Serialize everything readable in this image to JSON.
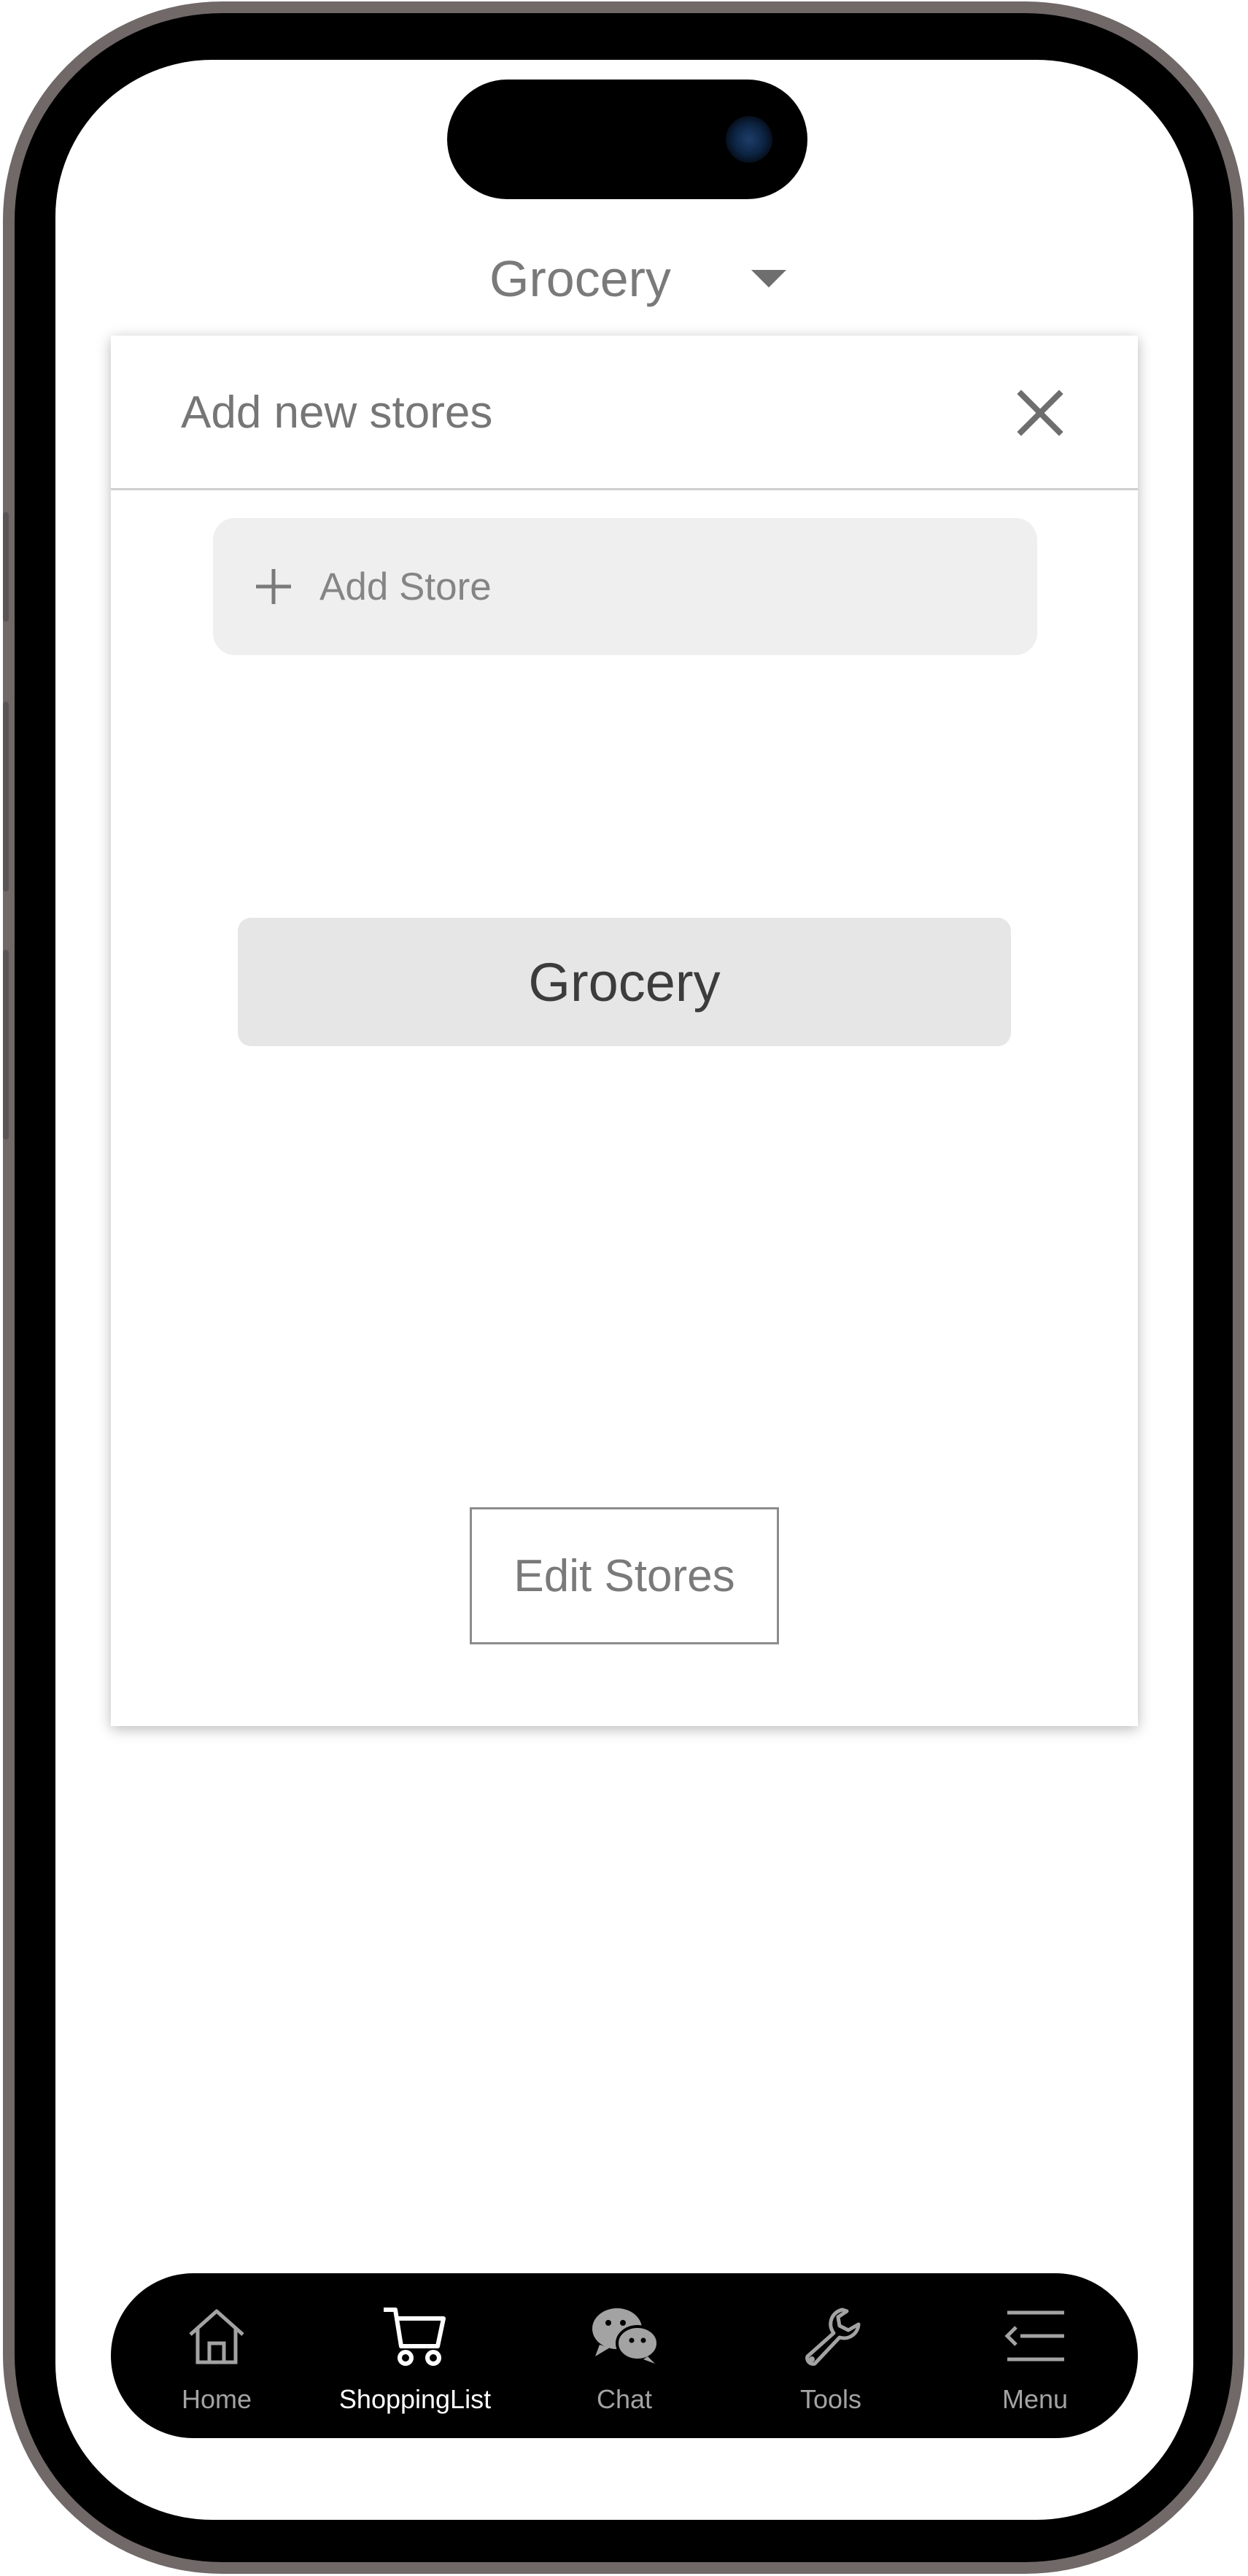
{
  "header": {
    "selected_store": "Grocery"
  },
  "modal": {
    "title": "Add new stores",
    "add_store_placeholder": "Add Store",
    "stores": [
      "Grocery"
    ],
    "edit_button_label": "Edit Stores"
  },
  "tabbar": {
    "active": "ShoppingList",
    "items": [
      {
        "label": "Home",
        "icon": "home-icon"
      },
      {
        "label": "ShoppingList",
        "icon": "cart-icon"
      },
      {
        "label": "Chat",
        "icon": "chat-bubbles-icon"
      },
      {
        "label": "Tools",
        "icon": "wrench-icon"
      },
      {
        "label": "Menu",
        "icon": "menu-icon"
      }
    ]
  },
  "colors": {
    "tabbar_bg": "#000000",
    "active_tab": "#ffffff",
    "inactive_tab": "#a3a3a3",
    "pill_bg": "#e6e6e6",
    "field_bg": "#efefef",
    "frame": "#716868"
  }
}
